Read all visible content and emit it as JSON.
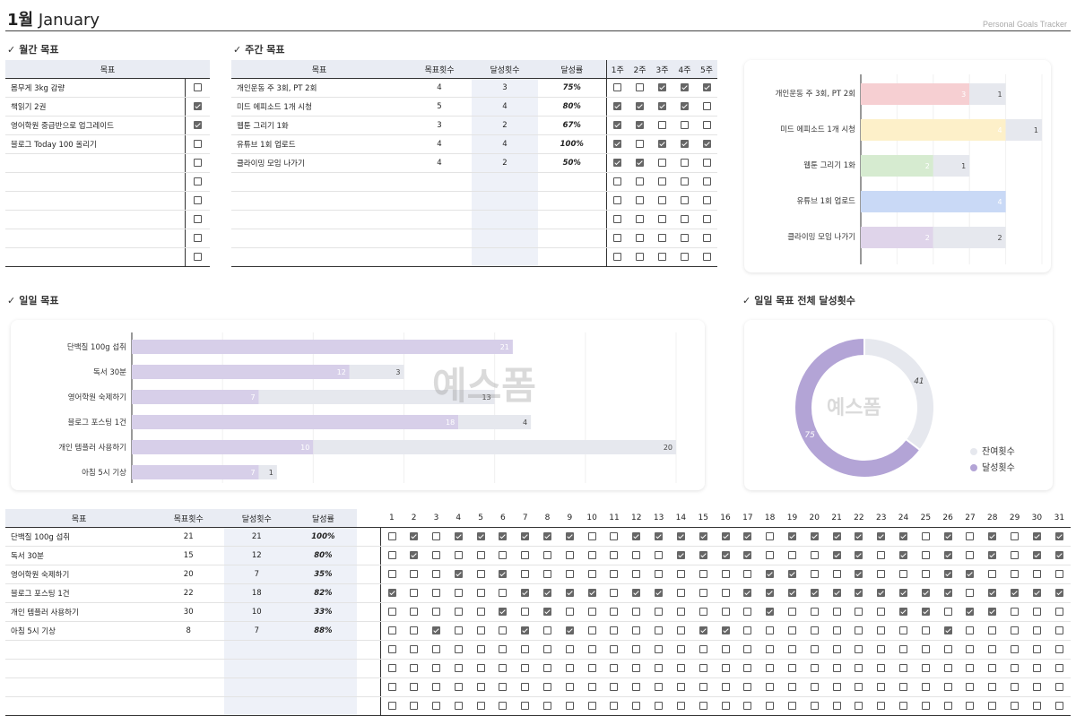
{
  "header": {
    "month": "1월",
    "month_en": "January",
    "subtitle": "Personal Goals Tracker"
  },
  "monthly": {
    "section_title": "월간 목표",
    "col_goal": "목표",
    "rows": [
      {
        "goal": "몸무게 3kg 감량",
        "done": false
      },
      {
        "goal": "책읽기 2권",
        "done": true
      },
      {
        "goal": "영어학원 중급반으로 업그레이드",
        "done": true
      },
      {
        "goal": "블로그 Today 100 올리기",
        "done": false
      },
      {
        "goal": "",
        "done": false
      },
      {
        "goal": "",
        "done": false
      },
      {
        "goal": "",
        "done": false
      },
      {
        "goal": "",
        "done": false
      },
      {
        "goal": "",
        "done": false
      },
      {
        "goal": "",
        "done": false
      }
    ]
  },
  "weekly": {
    "section_title": "주간 목표",
    "cols": [
      "목표",
      "목표횟수",
      "달성횟수",
      "달성률",
      "1주",
      "2주",
      "3주",
      "4주",
      "5주"
    ],
    "rows": [
      {
        "goal": "개인운동 주 3회, PT 2회",
        "target": "4",
        "achieved": "3",
        "rate": "75%",
        "weeks": [
          false,
          false,
          true,
          true,
          true
        ]
      },
      {
        "goal": "미드 에피소드 1개 시청",
        "target": "5",
        "achieved": "4",
        "rate": "80%",
        "weeks": [
          true,
          true,
          true,
          true,
          false
        ]
      },
      {
        "goal": "웹툰 그리기 1화",
        "target": "3",
        "achieved": "2",
        "rate": "67%",
        "weeks": [
          true,
          true,
          false,
          false,
          false
        ]
      },
      {
        "goal": "유튜브 1회 업로드",
        "target": "4",
        "achieved": "4",
        "rate": "100%",
        "weeks": [
          true,
          false,
          true,
          true,
          true
        ]
      },
      {
        "goal": "클라이밍 모임 나가기",
        "target": "4",
        "achieved": "2",
        "rate": "50%",
        "weeks": [
          true,
          true,
          false,
          false,
          false
        ]
      },
      {
        "goal": "",
        "target": "",
        "achieved": "",
        "rate": "",
        "weeks": [
          false,
          false,
          false,
          false,
          false
        ]
      },
      {
        "goal": "",
        "target": "",
        "achieved": "",
        "rate": "",
        "weeks": [
          false,
          false,
          false,
          false,
          false
        ]
      },
      {
        "goal": "",
        "target": "",
        "achieved": "",
        "rate": "",
        "weeks": [
          false,
          false,
          false,
          false,
          false
        ]
      },
      {
        "goal": "",
        "target": "",
        "achieved": "",
        "rate": "",
        "weeks": [
          false,
          false,
          false,
          false,
          false
        ]
      },
      {
        "goal": "",
        "target": "",
        "achieved": "",
        "rate": "",
        "weeks": [
          false,
          false,
          false,
          false,
          false
        ]
      }
    ]
  },
  "daily": {
    "section_title": "일일 목표",
    "cols": [
      "목표",
      "목표횟수",
      "달성횟수",
      "달성률"
    ],
    "days": [
      "1",
      "2",
      "3",
      "4",
      "5",
      "6",
      "7",
      "8",
      "9",
      "10",
      "11",
      "12",
      "13",
      "14",
      "15",
      "16",
      "17",
      "18",
      "19",
      "20",
      "21",
      "22",
      "23",
      "24",
      "25",
      "26",
      "27",
      "28",
      "29",
      "30",
      "31"
    ],
    "rows": [
      {
        "goal": "단백질 100g 섭취",
        "target": "21",
        "achieved": "21",
        "rate": "100%",
        "checks": "0101111110011111101111110101011"
      },
      {
        "goal": "독서 30분",
        "target": "15",
        "achieved": "12",
        "rate": "80%",
        "checks": "0100000000000111100011010101011"
      },
      {
        "goal": "영어학원 숙제하기",
        "target": "20",
        "achieved": "7",
        "rate": "35%",
        "checks": "0001010000000000011001000110000"
      },
      {
        "goal": "블로그 포스팅 1건",
        "target": "22",
        "achieved": "18",
        "rate": "82%",
        "checks": "1000001111011000111111111101111"
      },
      {
        "goal": "개인 템플러 사용하기",
        "target": "30",
        "achieved": "10",
        "rate": "33%",
        "checks": "0000010100000000010000011011000"
      },
      {
        "goal": "아침 5시 기상",
        "target": "8",
        "achieved": "7",
        "rate": "88%",
        "checks": "0010001010000011000000000100000"
      },
      {
        "goal": "",
        "target": "",
        "achieved": "",
        "rate": "",
        "checks": "0000000000000000000000000000000"
      },
      {
        "goal": "",
        "target": "",
        "achieved": "",
        "rate": "",
        "checks": "0000000000000000000000000000000"
      },
      {
        "goal": "",
        "target": "",
        "achieved": "",
        "rate": "",
        "checks": "0000000000000000000000000000000"
      },
      {
        "goal": "",
        "target": "",
        "achieved": "",
        "rate": "",
        "checks": "0000000000000000000000000000000"
      }
    ]
  },
  "donut_section_title": "일일 목표 전체 달성횟수",
  "watermark": "예스폼",
  "chart_data": [
    {
      "type": "bar",
      "orientation": "horizontal",
      "stacked": true,
      "categories": [
        "개인운동 주 3회, PT 2회",
        "미드 에피소드 1개 시청",
        "웹툰 그리기 1화",
        "유튜브 1회 업로드",
        "클라이밍 모임 나가기"
      ],
      "series": [
        {
          "values": [
            3,
            4,
            2,
            4,
            2
          ]
        },
        {
          "values": [
            1,
            1,
            1,
            0,
            2
          ]
        }
      ],
      "colors": [
        "#f6cfd2",
        "#fdf0c9",
        "#d6ebd0",
        "#c9d9f6",
        "#dfd4ea"
      ],
      "remain_color": "#e6e8ee",
      "xlim": [
        0,
        5
      ]
    },
    {
      "type": "bar",
      "orientation": "horizontal",
      "stacked": true,
      "categories": [
        "단백질 100g 섭취",
        "독서 30분",
        "영어학원 숙제하기",
        "블로그 포스팅 1건",
        "개인 템플러 사용하기",
        "아침 5시 기상"
      ],
      "series": [
        {
          "values": [
            21,
            12,
            7,
            18,
            10,
            7
          ]
        },
        {
          "values": [
            0,
            3,
            13,
            4,
            20,
            1
          ]
        }
      ],
      "colors": [
        "#d7cfe9",
        "#e6e8ee"
      ],
      "xlim": [
        0,
        30
      ]
    },
    {
      "type": "pie",
      "donut": true,
      "labels": [
        "잔여횟수",
        "달성횟수"
      ],
      "values": [
        41,
        75
      ],
      "colors": [
        "#e6e8ee",
        "#b3a4d6"
      ]
    }
  ]
}
